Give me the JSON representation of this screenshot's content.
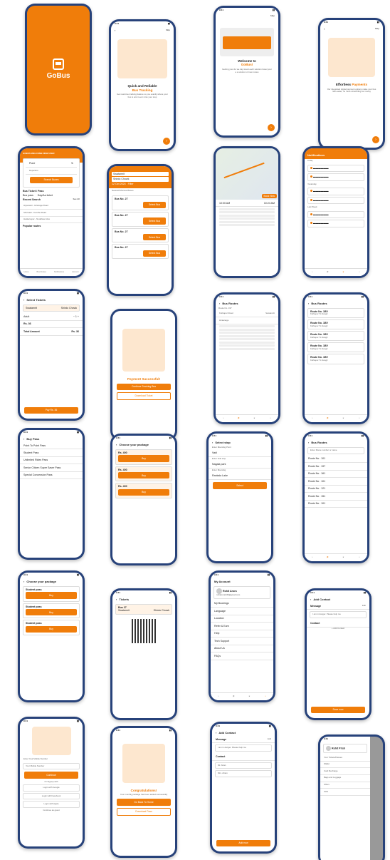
{
  "splash": {
    "brand": "GoBus"
  },
  "onb1": {
    "skip": "Skip",
    "title": "Quick and Reliable",
    "highlight": "Bus Tracking",
    "desc": "Get real-time tracking feature so you exactly where your bus is and never miss your stop"
  },
  "onb2": {
    "skip": "Skip",
    "title": "Welcome to",
    "highlight": "GoBus!",
    "desc": "Getting your do we day travel each solution travel your a a solution of new routes"
  },
  "onb3": {
    "skip": "Skip",
    "title": "Effortless",
    "highlight": "Payments",
    "desc": "Our integrated digital payment options make your bus ride easier, no more scrambling for money"
  },
  "home": {
    "banner": "GOBUS WELCOME NEW USER",
    "from": "Pune",
    "to": "",
    "departure": "Departure",
    "search": "Search Buses",
    "bus_ticket": "Bus Ticket / Pass",
    "opt1": "Bus pass",
    "opt2": "Day/Aa ticket",
    "recent": "Recent Search",
    "see_all": "See All",
    "r1": "Hiyanwari - Hiranage Road",
    "r2": "Shivwadi - Kondhe Road",
    "r3": "Hadavsopar - Nudahaa rides",
    "popular": "Popular routes",
    "nav": [
      "Home",
      "Bus Routes",
      "Notifications",
      "Account"
    ]
  },
  "search": {
    "from": "Swatamrit",
    "to": "Shirdo Chowk",
    "date": "12 Oct 2024",
    "filter": "Filter",
    "n": "Nearest/Shortest Buses",
    "bus": "Bus No. 27",
    "tag": "Select Bus"
  },
  "map": {
    "b1": "Booking",
    "t1": "10:00 AM",
    "t2": "10:24 AM",
    "label": "Book Now"
  },
  "notif": {
    "title": "Notifications",
    "today": "Today",
    "yesterday": "Yesterday",
    "last_week": "Last Week"
  },
  "select": {
    "title": "Select Tickets",
    "from": "Swatamrit",
    "to": "Shirdo Chowk",
    "adult": "Adult",
    "price": "Rs. 36",
    "total": "Total Amount",
    "pay": "Pay Rs. 36"
  },
  "payok": {
    "title": "Payment Successful!",
    "btn1": "Continue Tracking Bus",
    "btn2": "Download Ticket"
  },
  "busroute": {
    "title": "Bus Routes",
    "route": "Route No. 197",
    "a": "Kothapur Road",
    "b": "Swatamrit",
    "c": "Hiraanage"
  },
  "busroutes": {
    "title": "Bus Routes",
    "rno": "Route No. 1BV",
    "via": "Kolhapur To Sangli"
  },
  "buypass": {
    "title": "Buy Pass",
    "p1": "Point To Point Pass",
    "p2": "Student Pass",
    "p3": "Unlimited Rides Pass",
    "p4": "Senior Citizen Super Saver Pass",
    "p5": "Special Concession Pass"
  },
  "choose": {
    "title": "Choose your package",
    "price": "Rs. 400",
    "buy": "Buy"
  },
  "selstop": {
    "title": "Select stop",
    "l1": "Enter Boarding Point",
    "v1": "Vadi",
    "l2": "Enter final stop",
    "v2": "Nagala park",
    "l3": "Enter Boarding",
    "v3": "Rankala Lake",
    "btn": "Select"
  },
  "routes2": {
    "title": "Bus Routes",
    "search": "Enter Route number or name",
    "items": [
      "Route No : 101",
      "Route No : 197",
      "Route No : 161",
      "Route No : 101",
      "Route No : 121",
      "Route No : 151",
      "Route No : 101",
      "Route No : 101",
      "Route No : 121",
      "Route No : 191"
    ]
  },
  "choose2": {
    "title": "Choose your package",
    "sp": "Student pass",
    "buy": "Buy"
  },
  "tickets": {
    "title": "Tickets",
    "route": "Bus 27",
    "from": "Swatamrit",
    "to": "Shirdo Chowk"
  },
  "account": {
    "title": "My Account",
    "name": "Rohit Arora",
    "email": "rohitarora345@gmail.com",
    "items": [
      "My Bookings",
      "Language",
      "Location",
      "Refer & Earn",
      "Help",
      "Tech Support",
      "About Us",
      "FAQs"
    ]
  },
  "contact": {
    "title": "Add Contact",
    "message": "Message",
    "edit": "Edit",
    "msg": "I am in danger. Please help me",
    "contact": "Contact",
    "add": "+ Add Contact",
    "save": "Save now"
  },
  "login": {
    "label": "Enter Your Mobile Number",
    "ph": "Your Mobile Number",
    "btn": "Continue",
    "or": "Or Signup with",
    "g": "Login with Google",
    "f": "Login with Facebook",
    "a": "Login with Apple",
    "guest": "Continue as guest"
  },
  "congrats": {
    "title": "Congratulations!",
    "desc": "Your monthly package has been added successfully",
    "btn1": "Go Back To Home",
    "btn2": "Download Pass"
  },
  "contact2": {
    "title": "Add Contact",
    "message": "Message",
    "edit": "Edit",
    "msg": "I am in danger. Please help me",
    "contact": "Contact",
    "c1": "Mr. Ahan",
    "c2": "Mrs. Aham",
    "save": "Add now"
  },
  "drawer": {
    "name": "Rohit Prish",
    "items": [
      "Your Tickets/Passes",
      "Wallet",
      "Card Recharge",
      "Bags and Luggage",
      "Offers",
      "SOS"
    ]
  }
}
